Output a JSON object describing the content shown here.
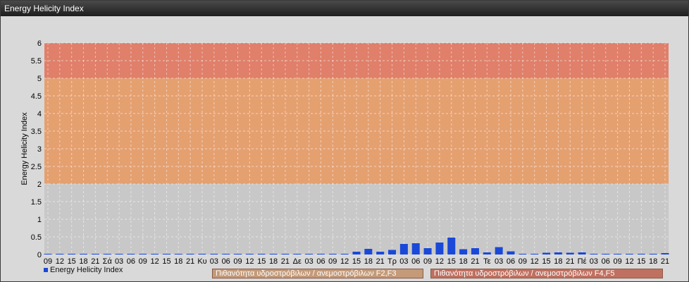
{
  "window_title": "Energy Helicity Index",
  "colors": {
    "bar": "#1a48d8",
    "band_low": "#c8c8c8",
    "band_mid": "#e5a070",
    "band_high": "#e07f6a",
    "legend_f23": "#c49a78",
    "legend_f45": "#c07060"
  },
  "legend": {
    "series_label": "Energy Helicity Index",
    "f23_label": "Πιθανότητα υδροστρόβιλων / ανεμοστρόβιλων F2,F3",
    "f45_label": "Πιθανότητα υδροστρόβιλων / ανεμοστρόβιλων F4,F5"
  },
  "chart_data": {
    "type": "bar",
    "title": "",
    "xlabel": "",
    "ylabel": "Energy Helicity Index",
    "ylim": [
      0,
      6
    ],
    "yticks": [
      "0",
      "0.5",
      "1",
      "1.5",
      "2",
      "2.5",
      "3",
      "3.5",
      "4",
      "4.5",
      "5",
      "5.5",
      "6"
    ],
    "grid": true,
    "legend_position": "bottom",
    "bands": [
      {
        "from": 0,
        "to": 2,
        "label": ""
      },
      {
        "from": 2,
        "to": 5,
        "label": "Πιθανότητα υδροστρόβιλων / ανεμοστρόβιλων F2,F3"
      },
      {
        "from": 5,
        "to": 6,
        "label": "Πιθανότητα υδροστρόβιλων / ανεμοστρόβιλων F4,F5"
      }
    ],
    "categories": [
      "09",
      "12",
      "15",
      "18",
      "21",
      "Σά",
      "03",
      "06",
      "09",
      "12",
      "15",
      "18",
      "21",
      "Κυ",
      "03",
      "06",
      "09",
      "12",
      "15",
      "18",
      "21",
      "Δε",
      "03",
      "06",
      "09",
      "12",
      "15",
      "18",
      "21",
      "Τρ",
      "03",
      "06",
      "09",
      "12",
      "15",
      "18",
      "21",
      "Τε",
      "03",
      "06",
      "09",
      "12",
      "15",
      "18",
      "21",
      "Πέ",
      "03",
      "06",
      "09",
      "12",
      "15",
      "18",
      "21"
    ],
    "series": [
      {
        "name": "Energy Helicity Index",
        "values": [
          0.01,
          0.01,
          0.01,
          0.01,
          0.01,
          0.01,
          0.01,
          0.01,
          0.01,
          0.01,
          0.01,
          0.01,
          0.01,
          0.01,
          0.01,
          0.01,
          0.01,
          0.01,
          0.01,
          0.01,
          0.01,
          0.01,
          0.01,
          0.01,
          0.01,
          0.01,
          0.08,
          0.16,
          0.08,
          0.13,
          0.3,
          0.32,
          0.18,
          0.34,
          0.48,
          0.15,
          0.18,
          0.06,
          0.21,
          0.09,
          0.02,
          0.02,
          0.05,
          0.06,
          0.05,
          0.06,
          0.01,
          0.01,
          0.01,
          0.01,
          0.01,
          0.01,
          0.04
        ]
      }
    ]
  }
}
